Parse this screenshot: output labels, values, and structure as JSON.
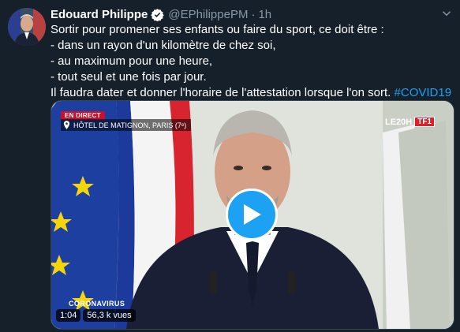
{
  "tweet": {
    "author_name": "Edouard Philippe",
    "handle": "@EPhilippePM",
    "separator": "·",
    "time": "1h",
    "lines": [
      "Sortir pour promener ses enfants ou faire du sport, ce doit être :",
      "- dans un rayon d'un kilomètre de chez soi,",
      "- au maximum pour une heure,",
      "- tout seul et une fois par jour."
    ],
    "last_line_text": "Il faudra dater et donner l'horaire de l'attestation lorsque l'on sort. ",
    "hashtag": "#COVID19"
  },
  "video": {
    "live_badge": "EN DIRECT",
    "location": "HÔTEL DE MATIGNON, PARIS (7ᵉ)",
    "channel_program": "LE20H",
    "channel_logo": "TF1",
    "banner": "CORONAVIRUS",
    "duration": "1:04",
    "views": "56,3 k vues"
  },
  "icons": {
    "verified": "verified-badge-icon",
    "more": "chevron-down-icon",
    "play": "play-icon",
    "location": "location-pin-icon"
  },
  "colors": {
    "background": "#15202b",
    "accent": "#1da1f2",
    "muted": "#8899a6",
    "live": "#c8102e"
  }
}
